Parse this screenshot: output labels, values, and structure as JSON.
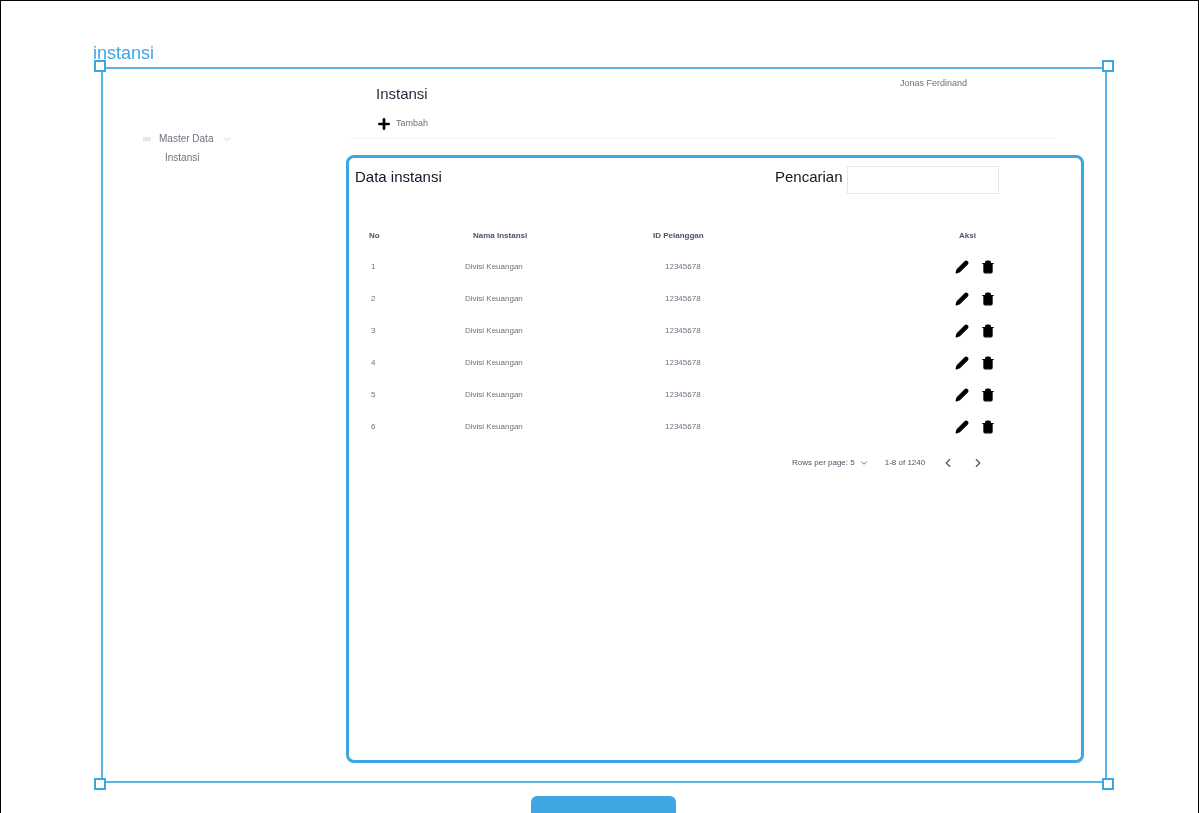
{
  "frame_label": "instansi",
  "sidebar": {
    "group": {
      "label": "Master Data",
      "expanded": true,
      "children": [
        {
          "label": "Instansi"
        }
      ]
    }
  },
  "header": {
    "title": "Instansi",
    "user": "Jonas Ferdinand"
  },
  "add_button": {
    "label": "Tambah"
  },
  "card": {
    "title": "Data instansi",
    "search": {
      "label": "Pencarian"
    }
  },
  "table": {
    "columns": [
      "No",
      "Nama Instansi",
      "ID Pelanggan",
      "Aksi"
    ],
    "rows": [
      {
        "no": "1",
        "name": "Divisi Keuangan",
        "id": "12345678"
      },
      {
        "no": "2",
        "name": "Divisi Keuangan",
        "id": "12345678"
      },
      {
        "no": "3",
        "name": "Divisi Keuangan",
        "id": "12345678"
      },
      {
        "no": "4",
        "name": "Divisi Keuangan",
        "id": "12345678"
      },
      {
        "no": "5",
        "name": "Divisi Keuangan",
        "id": "12345678"
      },
      {
        "no": "6",
        "name": "Divisi Keuangan",
        "id": "12345678"
      }
    ]
  },
  "pagination": {
    "rows_per_page": "Rows per page: 5",
    "range": "1-8 of 1240"
  }
}
